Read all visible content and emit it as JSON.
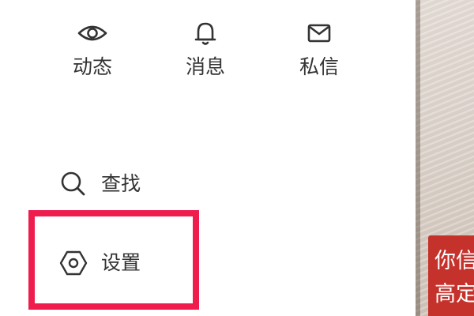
{
  "top_nav": {
    "items": [
      {
        "label": "动态",
        "icon": "eye-icon"
      },
      {
        "label": "消息",
        "icon": "bell-icon"
      },
      {
        "label": "私信",
        "icon": "mail-icon"
      }
    ]
  },
  "menu": {
    "search": {
      "label": "查找",
      "icon": "search-icon"
    },
    "settings": {
      "label": "设置",
      "icon": "hexagon-settings-icon"
    }
  },
  "video": {
    "caption_line1": "你信",
    "caption_line2": "高定"
  },
  "colors": {
    "highlight": "#ee1d4e",
    "caption_bg": "#c5322c",
    "text": "#333333"
  }
}
